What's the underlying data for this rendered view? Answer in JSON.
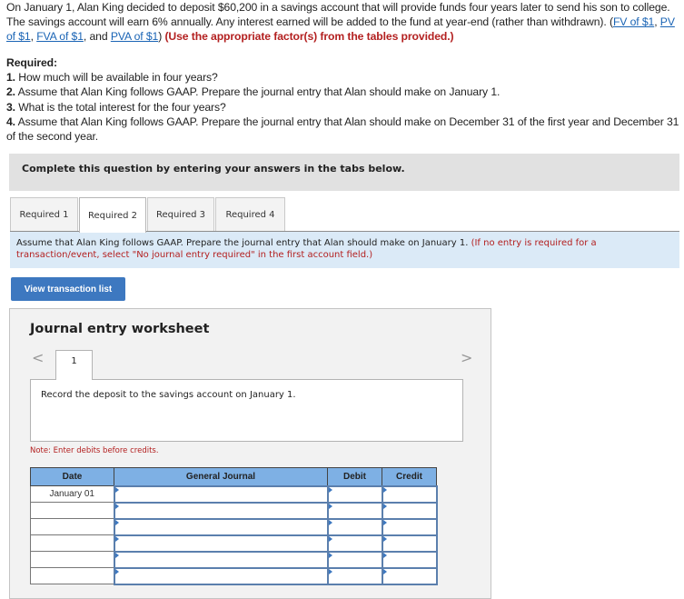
{
  "problem": {
    "text_before_links": "On January 1, Alan King decided to deposit $60,200 in a savings account that will provide funds four years later to send his son to college. The savings account will earn 6% annually. Any interest earned will be added to the fund at year-end (rather than withdrawn). (",
    "links": [
      "FV of $1",
      "PV of $1",
      "FVA of $1",
      "PVA of $1"
    ],
    "sep1": ", ",
    "sep2": ", ",
    "sep3": ", and ",
    "close_paren": ") ",
    "instruction": "(Use the appropriate factor(s) from the tables provided.)"
  },
  "required": {
    "heading": "Required:",
    "items": [
      {
        "num": "1.",
        "text": " How much will be available in four years?"
      },
      {
        "num": "2.",
        "text": " Assume that Alan King follows GAAP. Prepare the journal entry that Alan should make on January 1."
      },
      {
        "num": "3.",
        "text": " What is the total interest for the four years?"
      },
      {
        "num": "4.",
        "text": " Assume that Alan King follows GAAP. Prepare the journal entry that Alan should make on December 31 of the first year and December 31 of the second year."
      }
    ]
  },
  "banner": "Complete this question by entering your answers in the tabs below.",
  "tabs": [
    {
      "label": "Required 1",
      "active": false
    },
    {
      "label": "Required 2",
      "active": true
    },
    {
      "label": "Required 3",
      "active": false
    },
    {
      "label": "Required 4",
      "active": false
    }
  ],
  "instruction": {
    "text": "Assume that Alan King follows GAAP. Prepare the journal entry that Alan should make on January 1. ",
    "note": "(If no entry is required for a transaction/event, select \"No journal entry required\" in the first account field.)"
  },
  "view_button": "View transaction list",
  "worksheet": {
    "title": "Journal entry worksheet",
    "prev_icon": "<",
    "next_icon": ">",
    "entry_tab": "1",
    "entry_description": "Record the deposit to the savings account on January 1.",
    "note": "Note: Enter debits before credits.",
    "columns": [
      "Date",
      "General Journal",
      "Debit",
      "Credit"
    ],
    "rows": [
      {
        "date": "January 01",
        "account": "",
        "debit": "",
        "credit": ""
      },
      {
        "date": "",
        "account": "",
        "debit": "",
        "credit": ""
      },
      {
        "date": "",
        "account": "",
        "debit": "",
        "credit": ""
      },
      {
        "date": "",
        "account": "",
        "debit": "",
        "credit": ""
      },
      {
        "date": "",
        "account": "",
        "debit": "",
        "credit": ""
      },
      {
        "date": "",
        "account": "",
        "debit": "",
        "credit": ""
      }
    ]
  },
  "colors": {
    "link": "#1a64b5",
    "alert_red": "#b32020",
    "button_blue": "#3d78c0",
    "header_blue": "#7eb0e4",
    "instruction_bg": "#dbeaf7"
  }
}
